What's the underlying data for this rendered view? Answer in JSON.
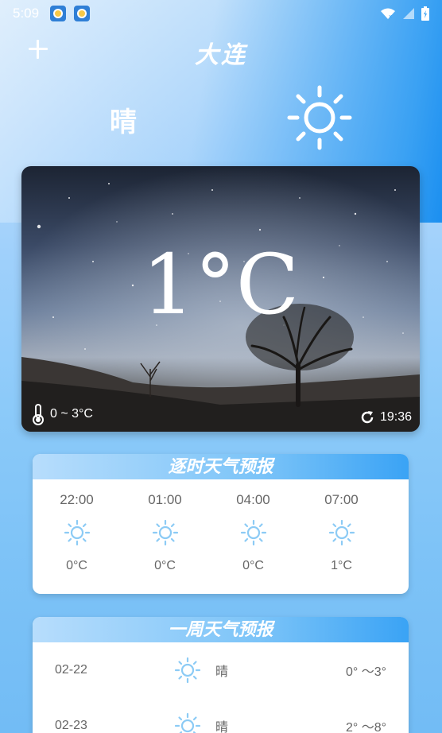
{
  "status": {
    "time": "5:09",
    "app_icons": [
      "alarm-app-icon",
      "alarm-app-icon"
    ],
    "right_icons": [
      "wifi-icon",
      "signal-icon",
      "battery-icon"
    ]
  },
  "header": {
    "city": "大连",
    "add_icon": "plus-icon"
  },
  "current": {
    "condition": "晴",
    "icon": "sun-icon",
    "temperature": "1°C",
    "range": "0 ~ 3°C",
    "update_time": "19:36"
  },
  "hourly": {
    "title": "逐时天气预报",
    "items": [
      {
        "time": "22:00",
        "temp": "0°C",
        "icon": "sun-icon"
      },
      {
        "time": "01:00",
        "temp": "0°C",
        "icon": "sun-icon"
      },
      {
        "time": "04:00",
        "temp": "0°C",
        "icon": "sun-icon"
      },
      {
        "time": "07:00",
        "temp": "1°C",
        "icon": "sun-icon"
      }
    ]
  },
  "weekly": {
    "title": "一周天气预报",
    "items": [
      {
        "date": "02-22",
        "condition": "晴",
        "range": "0° ～3°",
        "icon": "sun-icon"
      },
      {
        "date": "02-23",
        "condition": "晴",
        "range": "2° ～8°",
        "icon": "sun-icon"
      }
    ]
  },
  "colors": {
    "accent": "#1b8ff0",
    "sun_light": "#8ccbf5",
    "text_gray": "#666666"
  }
}
